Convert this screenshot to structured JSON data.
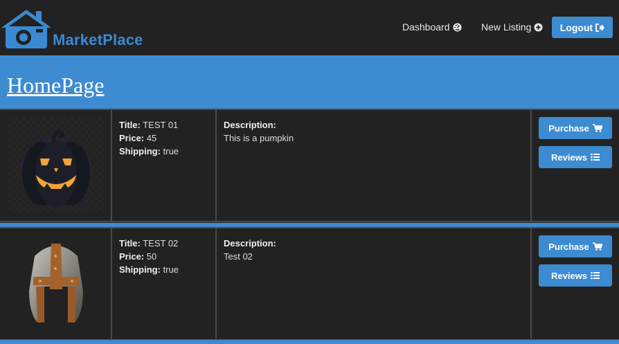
{
  "nav": {
    "brand": "MarketPlace",
    "dashboard_label": "Dashboard",
    "new_listing_label": "New Listing",
    "logout_label": "Logout"
  },
  "hero": {
    "title": "HomePage"
  },
  "field_labels": {
    "title": "Title:",
    "price": "Price:",
    "shipping": "Shipping:",
    "description": "Description:"
  },
  "buttons": {
    "purchase": "Purchase",
    "reviews": "Reviews"
  },
  "listings": [
    {
      "title": "TEST 01",
      "price": "45",
      "shipping": "true",
      "description": "This is a pumpkin",
      "image_icon": "jack-o-lantern"
    },
    {
      "title": "TEST 02",
      "price": "50",
      "shipping": "true",
      "description": "Test 02",
      "image_icon": "viking-helmet"
    }
  ],
  "colors": {
    "accent": "#3d8bd0",
    "background": "#222222",
    "border": "#4a4a4a"
  }
}
